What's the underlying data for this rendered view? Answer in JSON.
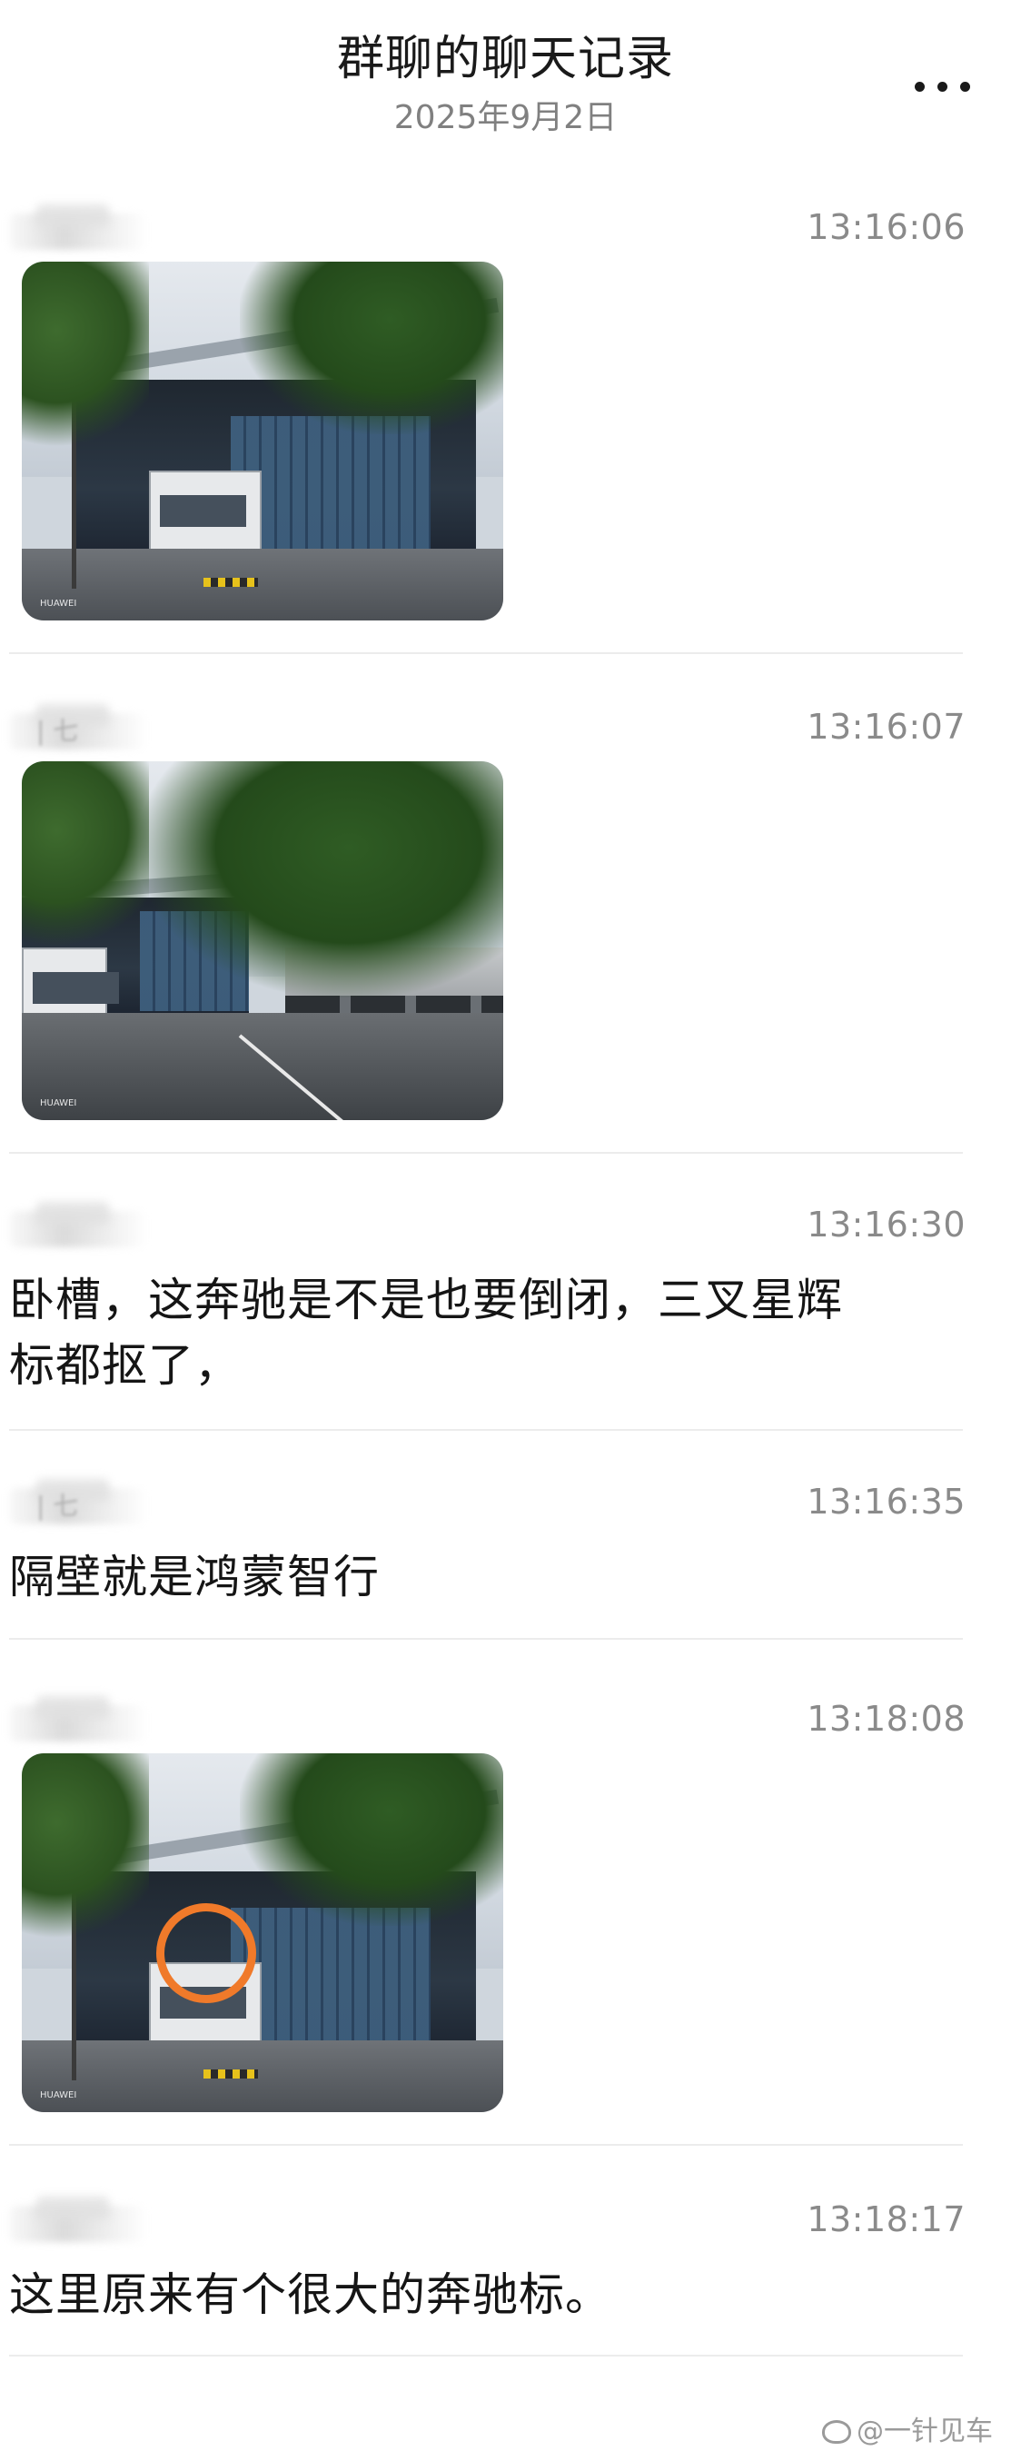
{
  "header": {
    "title": "群聊的聊天记录",
    "date": "2025年9月2日",
    "more_icon": "more-dots-icon"
  },
  "messages": [
    {
      "type": "image",
      "time": "13:16:06",
      "sender": "",
      "photo_caption": "HUAWEI"
    },
    {
      "type": "image",
      "time": "13:16:07",
      "sender": "| 七",
      "photo_caption": "HUAWEI"
    },
    {
      "type": "text",
      "time": "13:16:30",
      "sender": "",
      "lines": [
        "卧槽，这奔驰是不是也要倒闭，三叉星辉",
        "标都抠了，"
      ]
    },
    {
      "type": "text",
      "time": "13:16:35",
      "sender": "| 七",
      "lines": [
        "隔壁就是鸿蒙智行"
      ]
    },
    {
      "type": "image",
      "time": "13:18:08",
      "sender": "",
      "photo_caption": "HUAWEI",
      "annotation_color": "#f07a2a"
    },
    {
      "type": "text",
      "time": "13:18:17",
      "sender": "",
      "lines": [
        "这里原来有个很大的奔驰标。"
      ]
    }
  ],
  "footer": {
    "watermark": "@一针见车",
    "icon": "weibo-icon"
  }
}
